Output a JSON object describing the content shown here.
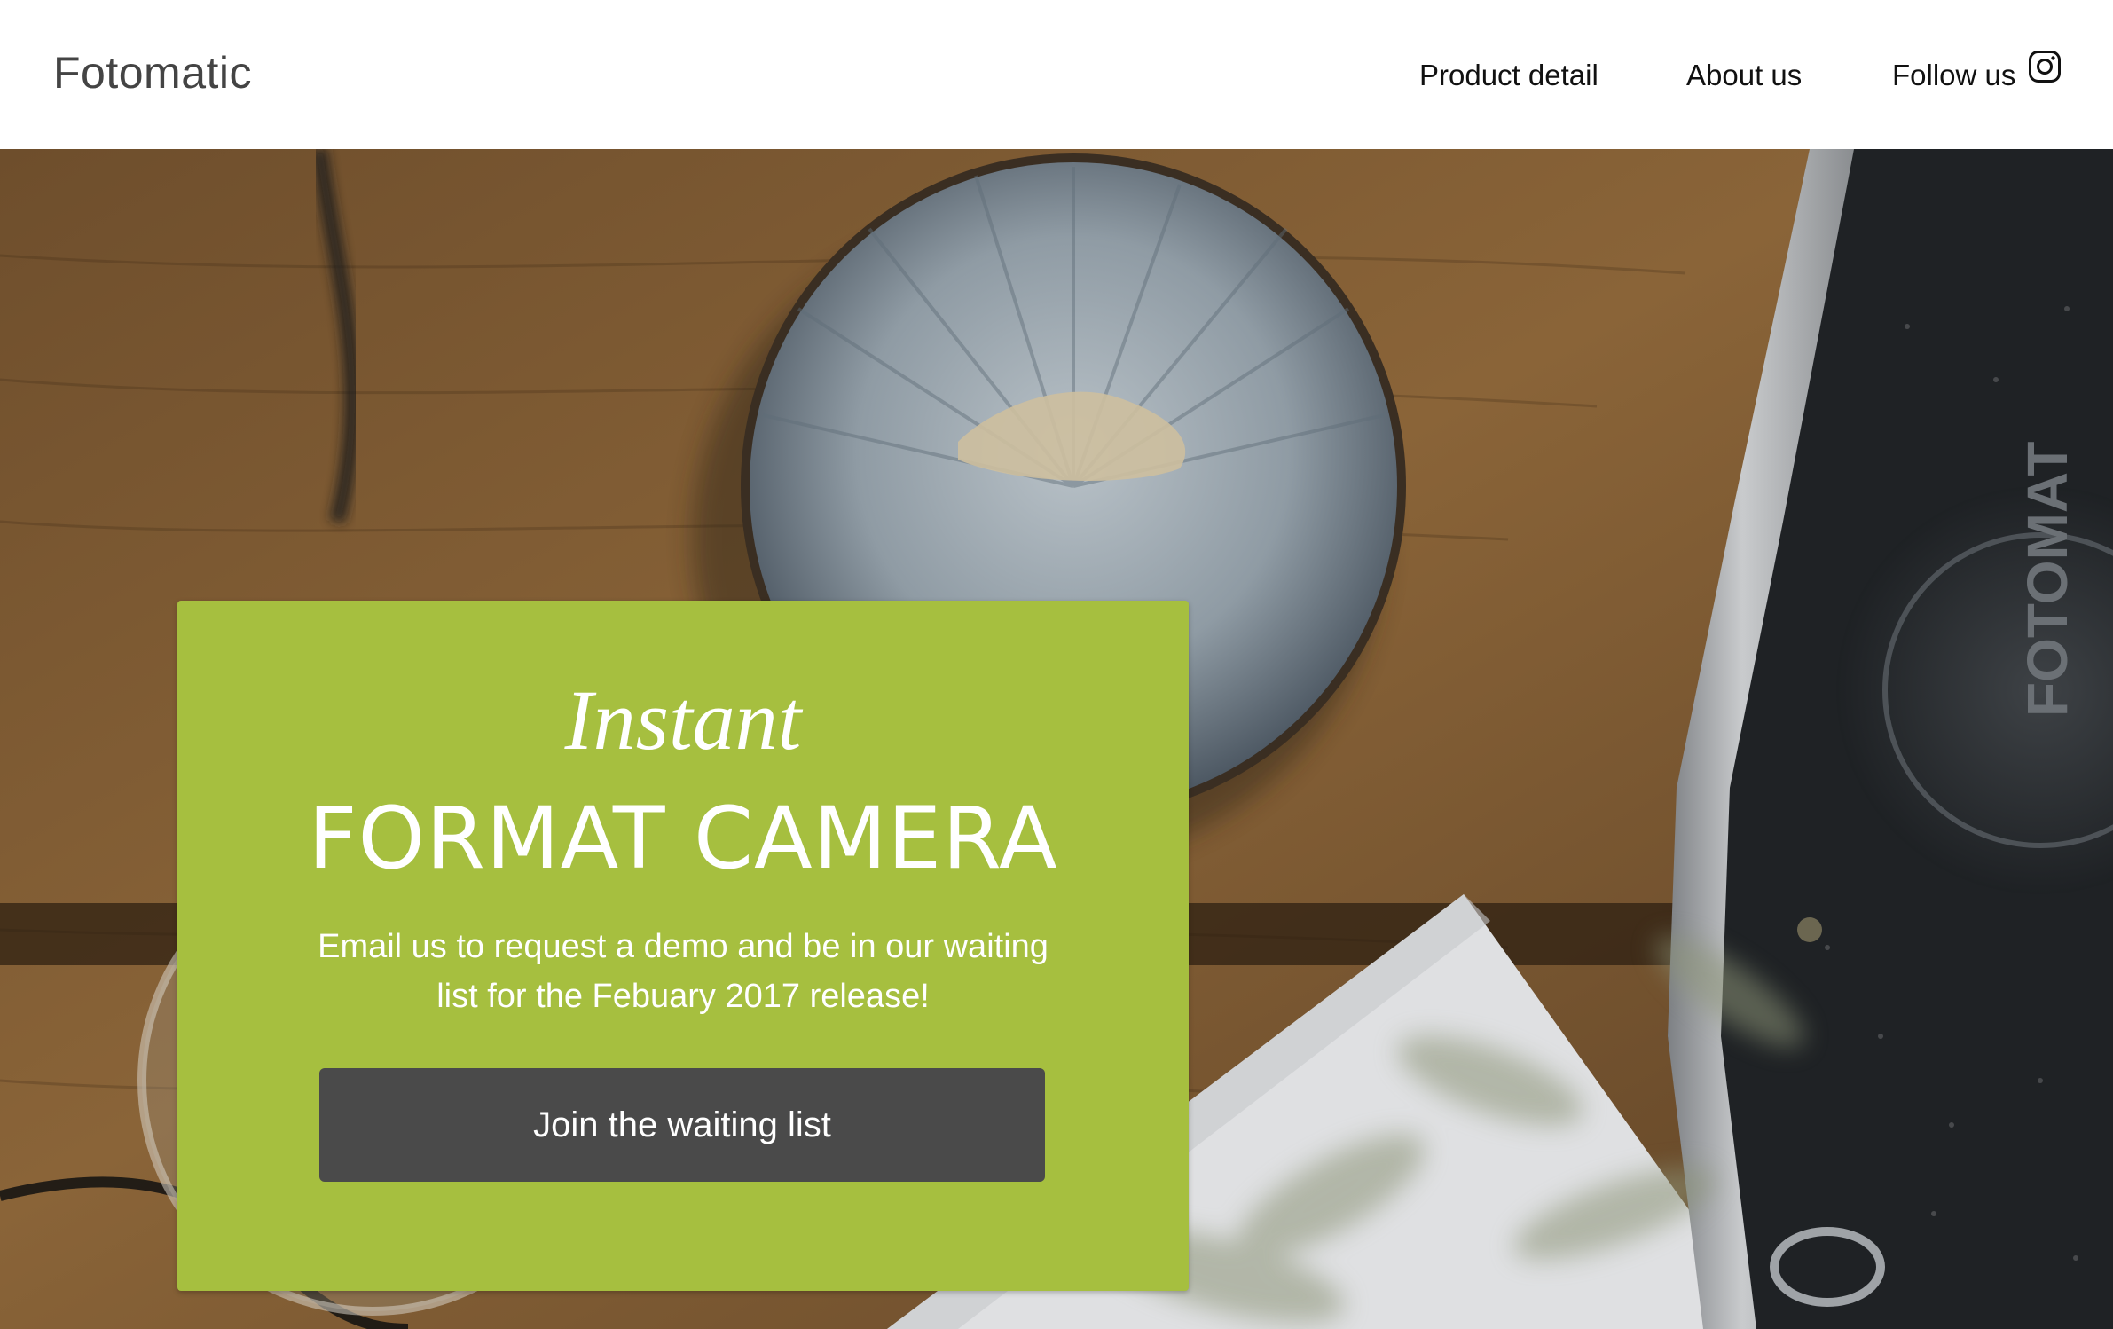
{
  "header": {
    "brand": "Fotomatic",
    "nav": [
      {
        "label": "Product detail"
      },
      {
        "label": "About us"
      },
      {
        "label": "Follow us",
        "icon": "instagram-icon"
      }
    ]
  },
  "hero": {
    "background": "photo of a wooden table with a ceramic bowl, a glass jar, a white card, a plant and a vintage camera",
    "card": {
      "kicker": "Instant",
      "title": "FORMAT CAMERA",
      "text": "Email us to request a demo and be in our waiting list for the Febuary 2017 release!",
      "button_label": "Join the waiting list",
      "color": "#a6bf3f",
      "button_color": "#4a4a4a"
    },
    "camera_cap_text": "FOTOMAT"
  }
}
